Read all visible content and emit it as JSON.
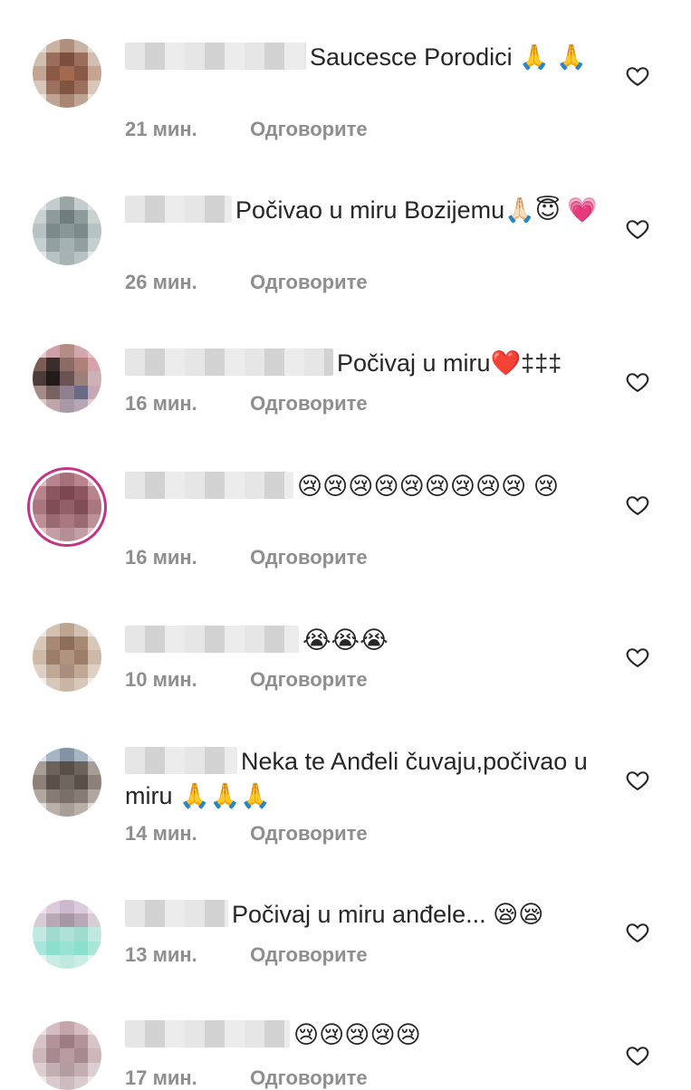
{
  "reply_label": "Одговорите",
  "comments": [
    {
      "text": "Saucesce Porodici 🙏 🙏",
      "time": "21 мин."
    },
    {
      "text": "Počivao u miru Bozijemu🙏🏻😇 💗",
      "time": "26 мин."
    },
    {
      "text": "Počivaj u miru❤️‡‡‡",
      "time": "16 мин."
    },
    {
      "text": "😢😢😢😢😢😢😢😢😢 😢",
      "time": "16 мин."
    },
    {
      "text": "😭😭😭",
      "time": "10 мин."
    },
    {
      "text": "Neka te Anđeli čuvaju,počivao u miru 🙏🙏🙏",
      "time": "14 мин."
    },
    {
      "text": "Počivaj u miru anđele... 😪😪",
      "time": "13 мин."
    },
    {
      "text": "😢😢😢😢😢",
      "time": "17 мин."
    }
  ],
  "icons": {
    "like": "heart-outline-icon"
  },
  "colors": {
    "text": "#262626",
    "meta": "#8e8e8e",
    "story_ring": "#c13584"
  }
}
